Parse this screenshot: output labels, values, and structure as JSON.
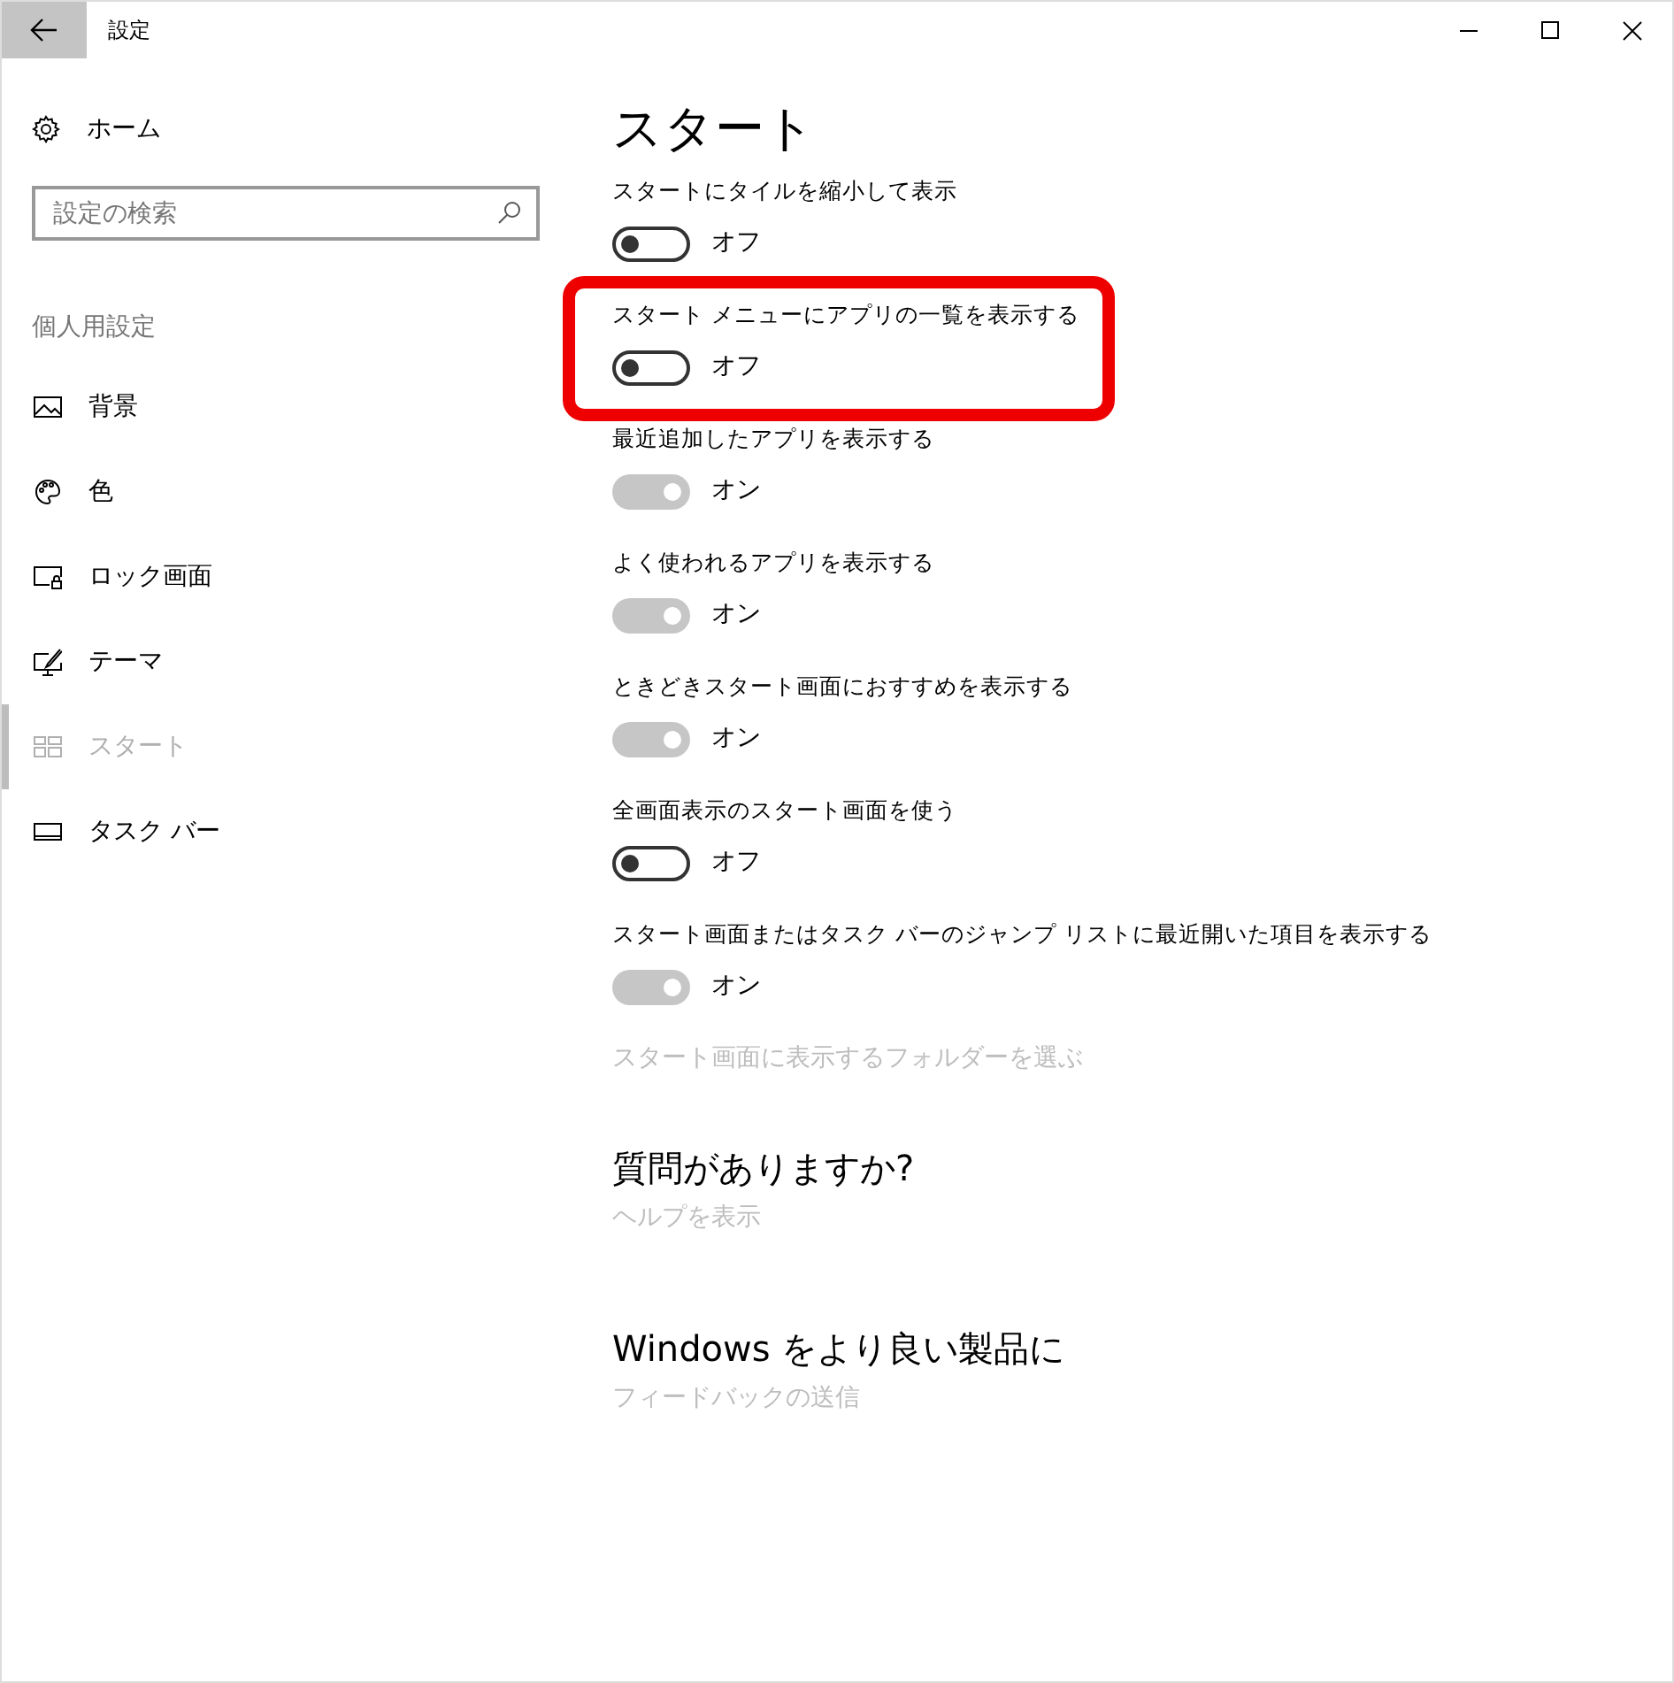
{
  "window": {
    "title": "設定"
  },
  "sidebar": {
    "home": "ホーム",
    "search": {
      "placeholder": "設定の検索"
    },
    "section": "個人用設定",
    "items": [
      {
        "label": "背景",
        "kind": "image",
        "selected": false
      },
      {
        "label": "色",
        "kind": "palette",
        "selected": false
      },
      {
        "label": "ロック画面",
        "kind": "lock",
        "selected": false
      },
      {
        "label": "テーマ",
        "kind": "theme",
        "selected": false
      },
      {
        "label": "スタート",
        "kind": "start",
        "selected": true
      },
      {
        "label": "タスク バー",
        "kind": "taskbar",
        "selected": false
      }
    ]
  },
  "page": {
    "title": "スタート",
    "settings": [
      {
        "label": "スタートにタイルを縮小して表示",
        "on": false,
        "state": "オフ",
        "highlighted": false
      },
      {
        "label": "スタート メニューにアプリの一覧を表示する",
        "on": false,
        "state": "オフ",
        "highlighted": true
      },
      {
        "label": "最近追加したアプリを表示する",
        "on": true,
        "state": "オン",
        "highlighted": false
      },
      {
        "label": "よく使われるアプリを表示する",
        "on": true,
        "state": "オン",
        "highlighted": false
      },
      {
        "label": "ときどきスタート画面におすすめを表示する",
        "on": true,
        "state": "オン",
        "highlighted": false
      },
      {
        "label": "全画面表示のスタート画面を使う",
        "on": false,
        "state": "オフ",
        "highlighted": false
      },
      {
        "label": "スタート画面またはタスク バーのジャンプ リストに最近開いた項目を表示する",
        "on": true,
        "state": "オン",
        "highlighted": false
      }
    ],
    "folder_link": "スタート画面に表示するフォルダーを選ぶ",
    "sections": [
      {
        "heading": "質問がありますか?",
        "link": "ヘルプを表示"
      },
      {
        "heading": "Windows をより良い製品に",
        "link": "フィードバックの送信"
      }
    ]
  }
}
